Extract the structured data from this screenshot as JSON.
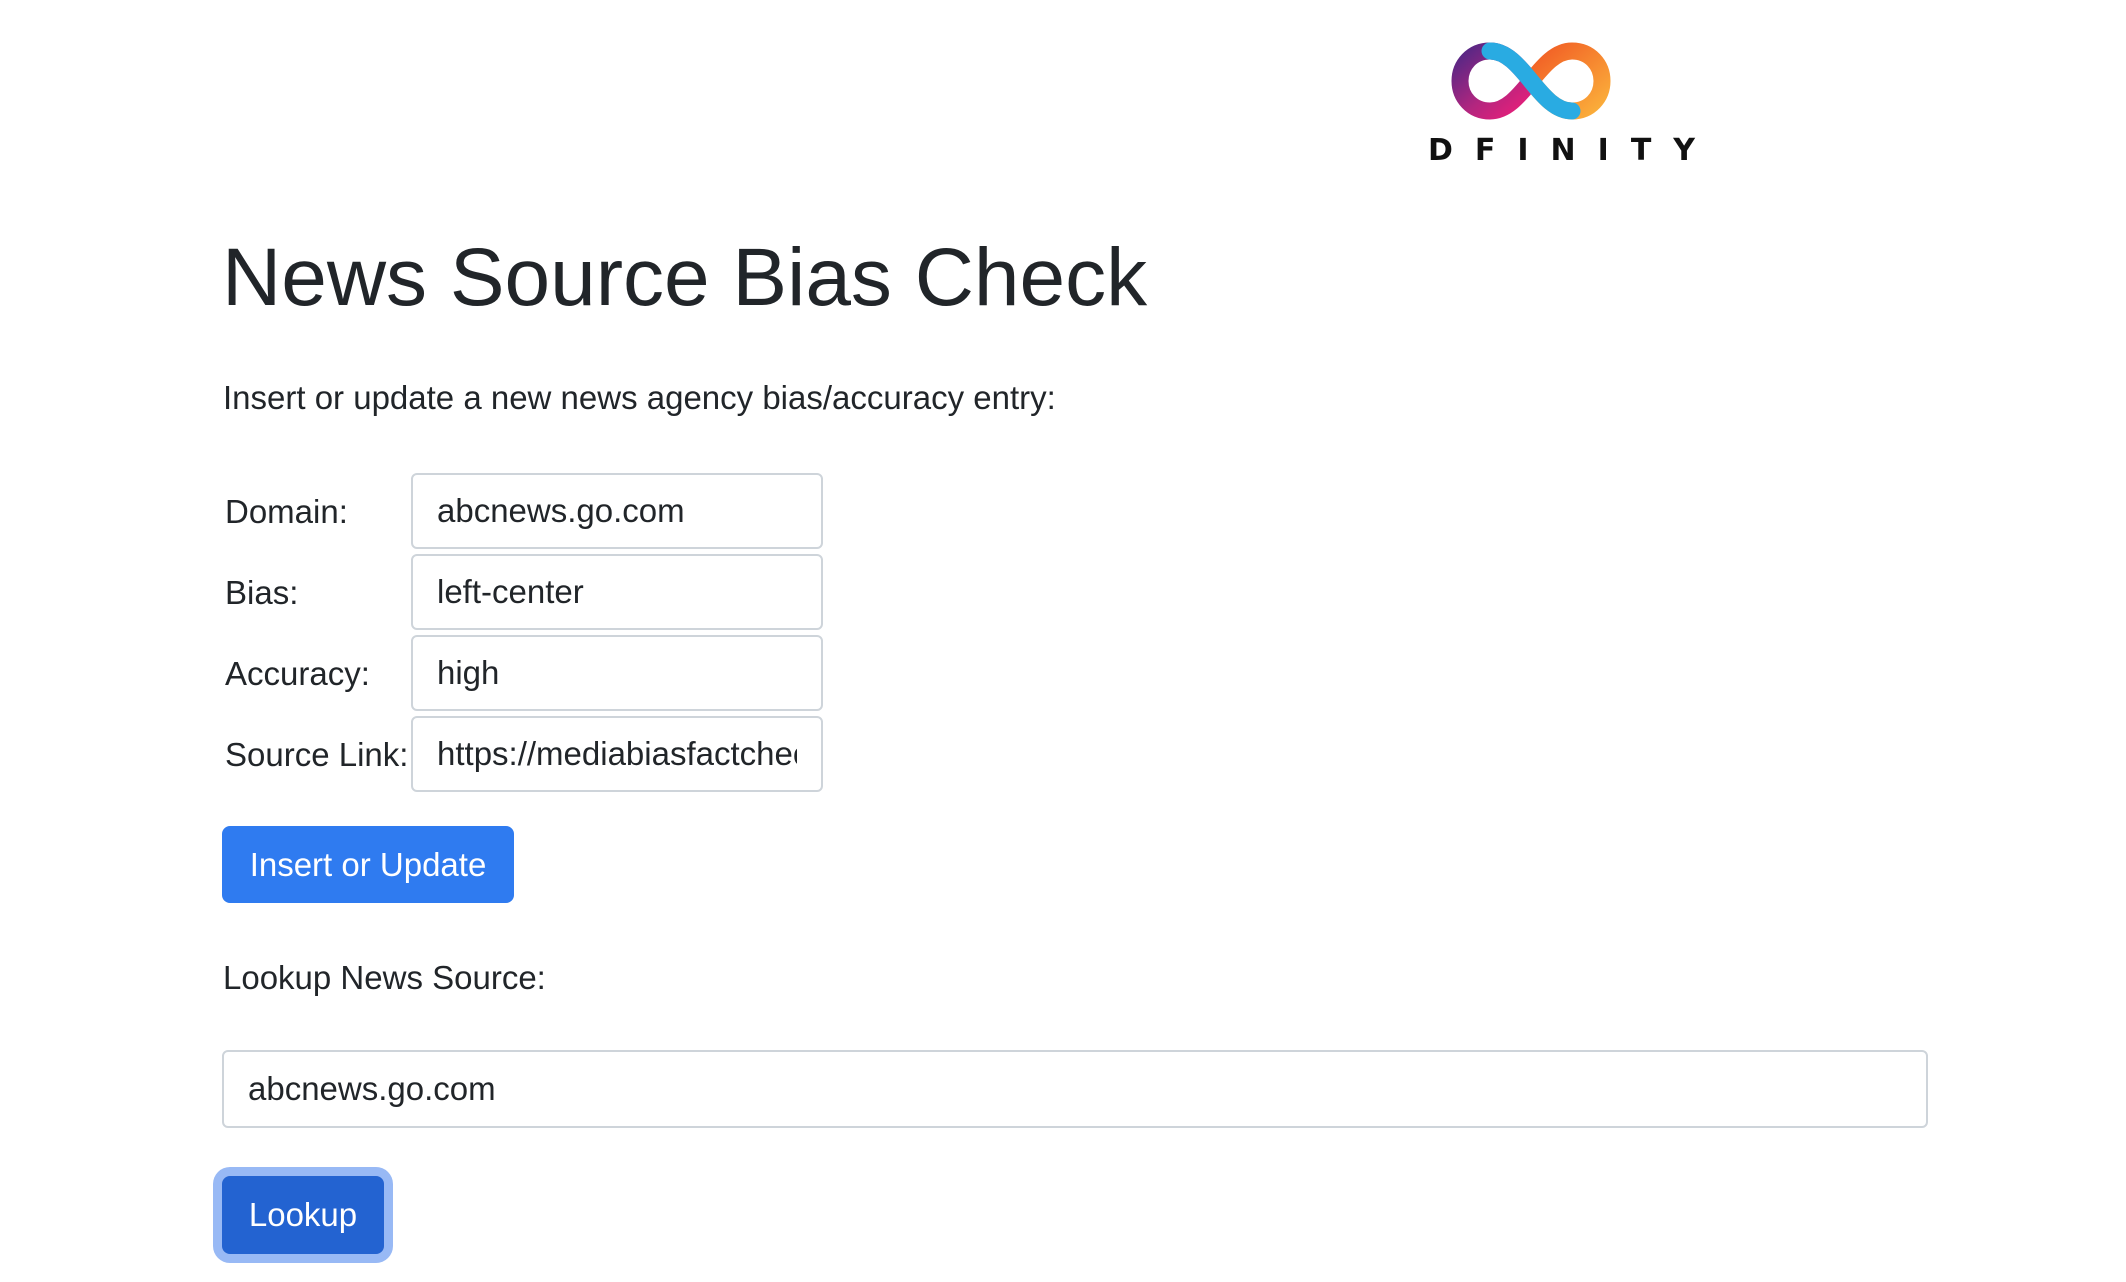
{
  "brand": {
    "wordmark": "DFINITY",
    "logo_icon": "infinity-logo-icon",
    "colors": {
      "purple": "#522785",
      "pink": "#ed1e79",
      "blue": "#29abe2",
      "orange": "#f15a24",
      "yellow": "#fbb03b"
    }
  },
  "page": {
    "title": "News Source Bias Check",
    "intro": "Insert or update a new news agency bias/accuracy entry:"
  },
  "form": {
    "domain": {
      "label": "Domain:",
      "value": "abcnews.go.com"
    },
    "bias": {
      "label": "Bias:",
      "value": "left-center"
    },
    "accuracy": {
      "label": "Accuracy:",
      "value": "high"
    },
    "source_link": {
      "label": "Source Link:",
      "value": "https://mediabiasfactcheck.com/abc-news/"
    },
    "submit_label": "Insert or Update"
  },
  "lookup": {
    "label": "Lookup News Source:",
    "value": "abcnews.go.com",
    "button_label": "Lookup"
  },
  "colors": {
    "primary_button": "#2f7bf0",
    "focused_button": "#2363d1",
    "focus_ring": "#98b9f5",
    "input_border": "#ced4da",
    "text": "#212529"
  }
}
